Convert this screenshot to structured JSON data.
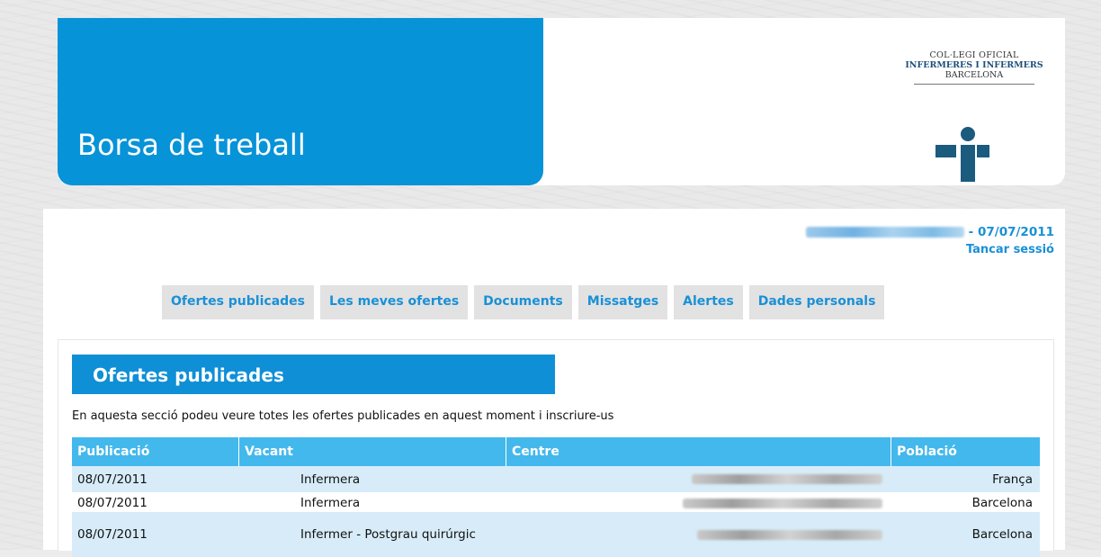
{
  "header": {
    "site_title": "Borsa de treball",
    "logo": {
      "line1": "COL·LEGI OFICIAL",
      "line2": "INFERMERES I INFERMERS",
      "line3": "BARCELONA"
    }
  },
  "user": {
    "date_suffix": " - 07/07/2011",
    "logout_label": "Tancar sessió"
  },
  "tabs": [
    {
      "label": "Ofertes publicades"
    },
    {
      "label": "Les meves ofertes"
    },
    {
      "label": "Documents"
    },
    {
      "label": "Missatges"
    },
    {
      "label": "Alertes"
    },
    {
      "label": "Dades personals"
    }
  ],
  "section": {
    "title": "Ofertes publicades",
    "intro": "En aquesta secció podeu veure totes les ofertes publicades en aquest moment i inscriure-us"
  },
  "table": {
    "headers": [
      "Publicació",
      "Vacant",
      "Centre",
      "Població"
    ],
    "rows": [
      {
        "date": "08/07/2011",
        "vacant": "Infermera",
        "place": "França"
      },
      {
        "date": "08/07/2011",
        "vacant": "Infermera",
        "place": "Barcelona"
      },
      {
        "date": "08/07/2011",
        "vacant": "Infermer - Postgrau quirúrgic",
        "place": "Barcelona"
      }
    ]
  },
  "colors": {
    "brand_blue": "#0793d8",
    "link_blue": "#1a90d6",
    "table_header": "#43b8ec",
    "row_stripe": "#d7ecf8"
  }
}
